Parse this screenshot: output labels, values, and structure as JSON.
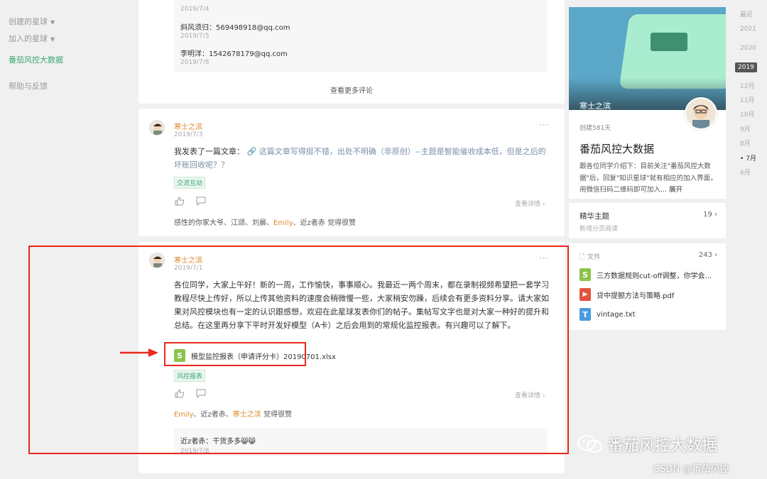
{
  "left_nav": {
    "created_planets": "创建的星球",
    "joined_planets": "加入的星球",
    "current_planet": "番茄风控大数据",
    "help": "帮助与反馈"
  },
  "feed": {
    "top_comments": [
      {
        "author": "",
        "date": "2019/7/4"
      },
      {
        "author": "斜风须归：569498918@qq.com",
        "date": "2019/7/5"
      },
      {
        "author": "李明洋：1542678179@qq.com",
        "date": "2019/7/8"
      }
    ],
    "see_more_comments": "查看更多评论",
    "post1": {
      "author": "寒士之滨",
      "date": "2019/7/3",
      "text_before_link": "我发表了一篇文章：",
      "link_text": "这篇文章写得挺不错，出处不明确（非原创）--主题是智能催收成本低，但是之后的坏账回收呢？？",
      "tag": "交流互动",
      "detail": "查看详情",
      "likes_text": "感性的你家大爷、江颂、刘晨、",
      "likes_em": "Emily",
      "likes_end": "、近z者赤 觉得很赞"
    },
    "post2": {
      "author": "寒士之滨",
      "date": "2019/7/1",
      "text": "各位同学，大家上午好！新的一周，工作愉快，事事顺心。我最近一两个周末，都在录制视频希望把一套学习教程尽快上传好，所以上传其他资料的速度会稍微慢一些，大家稍安勿躁，后续会有更多资料分享。请大家如果对风控模块也有一定的认识跟感想，欢迎在此星球发表你们的帖子。集帖写文字也是对大家一种好的提升和总结。在这里再分享下平时开发好模型（A卡）之后会用到的常规化监控报表。有兴趣可以了解下。",
      "attachment_icon": "S",
      "attachment": "模型监控报表（申请评分卡）20190701.xlsx",
      "tag": "风控报表",
      "detail": "查看详情",
      "likes_em1": "Emily",
      "likes_mid": "、近z者赤、",
      "likes_em2": "寒士之滨",
      "likes_end": " 觉得很赞",
      "reply": "近z者赤：干货多多😸😸",
      "reply_date": "2019/7/8"
    }
  },
  "side": {
    "owner": "寒士之滨",
    "created": "创建581天",
    "title": "番茄风控大数据",
    "desc": "跟各位同学介绍下：目前关注\"番茄风控大数据\"后，回复\"知识星球\"就有相应的加入界面，用微信扫码二维码即可加入...",
    "expand": "展开",
    "featured_title": "精华主题",
    "featured_sub": "新增分页阅读",
    "featured_count": "19",
    "files_title": "文件",
    "files_count": "243",
    "files": [
      {
        "icon": "S",
        "name": "三方数据规则cut-off调整，你学会..."
      },
      {
        "icon": "▶",
        "name": "贷中提额方法与策略.pdf"
      },
      {
        "icon": "T",
        "name": "vintage.txt"
      }
    ]
  },
  "timeline": [
    "最近",
    "2021",
    "2020",
    "2019",
    "12月",
    "11月",
    "10月",
    "9月",
    "8月",
    "7月",
    "6月"
  ],
  "watermark": {
    "brand": "番茄风控大数据",
    "csdn": "CSDN @番茄风控"
  },
  "colors": {
    "accent_green": "#3ba776",
    "author_orange": "#e08a2e",
    "annotation_red": "#e8291c"
  }
}
